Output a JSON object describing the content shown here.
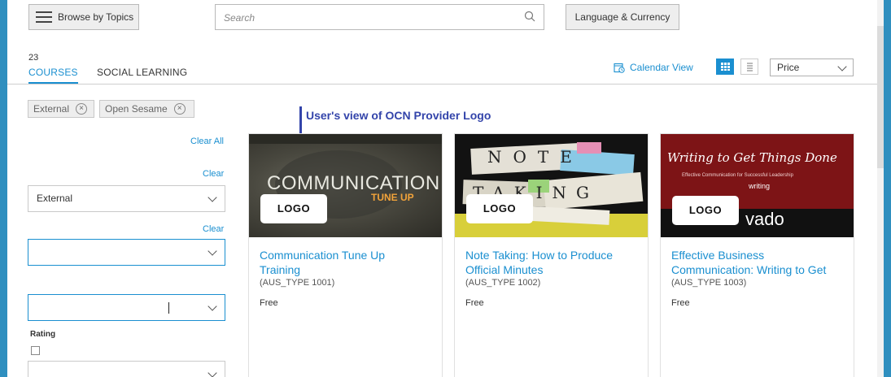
{
  "header": {
    "browse_label": "Browse by Topics",
    "search_placeholder": "Search",
    "lang_label": "Language & Currency"
  },
  "results": {
    "count": "23",
    "tabs": [
      "COURSES",
      "SOCIAL LEARNING"
    ],
    "calendar_view": "Calendar View",
    "sort_value": "Price"
  },
  "filters": {
    "chips": [
      "External",
      "Open Sesame"
    ],
    "clear_all": "Clear All",
    "clear": "Clear",
    "type_select_value": "External",
    "rating_label": "Rating"
  },
  "callout": "User's view of OCN Provider Logo",
  "cards": [
    {
      "title_lines": [
        "Communication Tune Up",
        "Training"
      ],
      "code_prefix": "(AUS_TYPE",
      "code_num": "1001)",
      "price": "Free",
      "logo": "LOGO",
      "image_text": [
        "COMMUNICATION",
        "TUNE UP"
      ]
    },
    {
      "title_lines": [
        "Note Taking: How to Produce",
        "Official Minutes"
      ],
      "code_prefix": "(AUS_TYPE",
      "code_num": "1002)",
      "price": "Free",
      "logo": "LOGO",
      "image_text": [
        "NOTE",
        "TAKING"
      ]
    },
    {
      "title_lines": [
        "Effective Business",
        "Communication: Writing to Get"
      ],
      "code_prefix": "(AUS_TYPE",
      "code_num": "1003)",
      "price": "Free",
      "logo": "LOGO",
      "image_text": [
        "Writing to Get Things Done",
        "Effective Communication for Successful Leadership",
        "writing",
        "vado"
      ]
    }
  ],
  "colors": {
    "accent": "#1a8fd0",
    "callout": "#3344aa",
    "frame": "#2f8fbf"
  },
  "icons": [
    "hamburger-icon",
    "search-icon",
    "calendar-icon",
    "grid-view-icon",
    "list-view-icon",
    "chevron-down-icon",
    "close-circle-icon"
  ]
}
